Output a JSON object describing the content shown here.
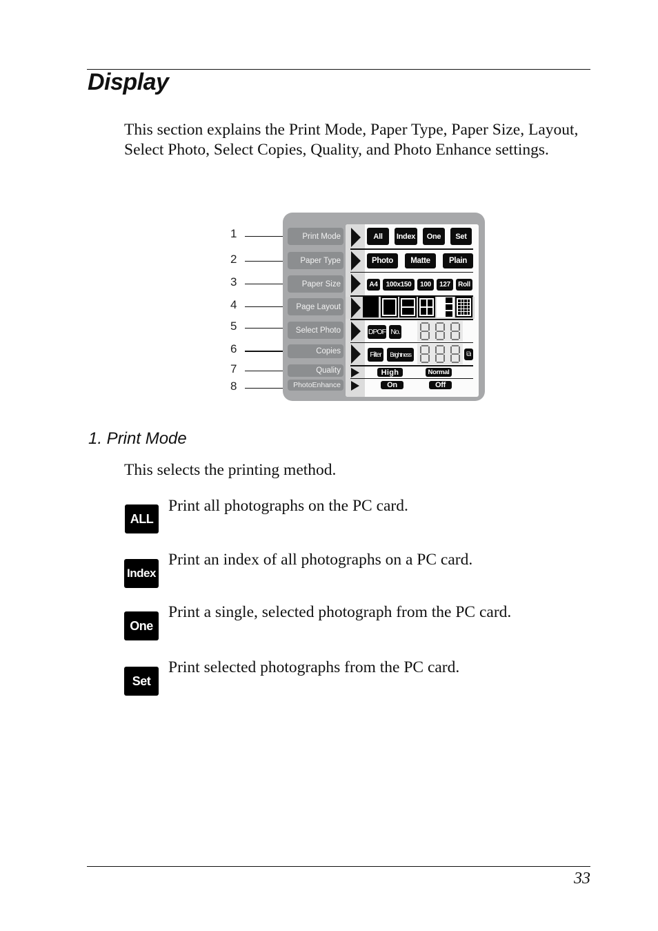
{
  "page": {
    "section_title": "Display",
    "intro": "This section explains the Print Mode, Paper Type, Paper Size, Layout, Select Photo, Select Copies, Quality, and Photo Enhance settings.",
    "page_number": "33"
  },
  "diagram": {
    "callouts": [
      "1",
      "2",
      "3",
      "4",
      "5",
      "6",
      "7",
      "8"
    ],
    "labels": [
      "Print Mode",
      "Paper Type",
      "Paper Size",
      "Page Layout",
      "Select Photo",
      "Copies",
      "Quality",
      "PhotoEnhance"
    ],
    "print_mode": [
      "All",
      "Index",
      "One",
      "Set"
    ],
    "paper_type": [
      "Photo",
      "Matte",
      "Plain"
    ],
    "paper_size": [
      "A4",
      "100x150",
      "100",
      "127",
      "Roll"
    ],
    "page_layout_icons": [
      "borderless-icon",
      "single-bordered-icon",
      "two-up-icon",
      "four-up-icon",
      "three-up-icon",
      "index-grid-icon"
    ],
    "select_photo": [
      "DPOF",
      "No."
    ],
    "copies": [
      "Filter",
      "Brightness"
    ],
    "seven_segment_digits": "888",
    "quality": [
      "High",
      "Normal"
    ],
    "photo_enhance": [
      "On",
      "Off"
    ],
    "colors": {
      "panel_bg": "#a7a8aa",
      "label_bg": "#8c8e90",
      "screen_bg": "#fbfbfb",
      "tag_bg": "#0c0c0c"
    }
  },
  "print_mode_section": {
    "title": "1. Print Mode",
    "description": "This selects the printing method.",
    "items": [
      {
        "icon_label": "ALL",
        "text": "Print all photographs on the PC card."
      },
      {
        "icon_label": "Index",
        "text": "Print an index of all photographs on a PC card."
      },
      {
        "icon_label": "One",
        "text": "Print a single, selected photograph from the PC card."
      },
      {
        "icon_label": "Set",
        "text": "Print selected photographs from the PC card."
      }
    ]
  }
}
